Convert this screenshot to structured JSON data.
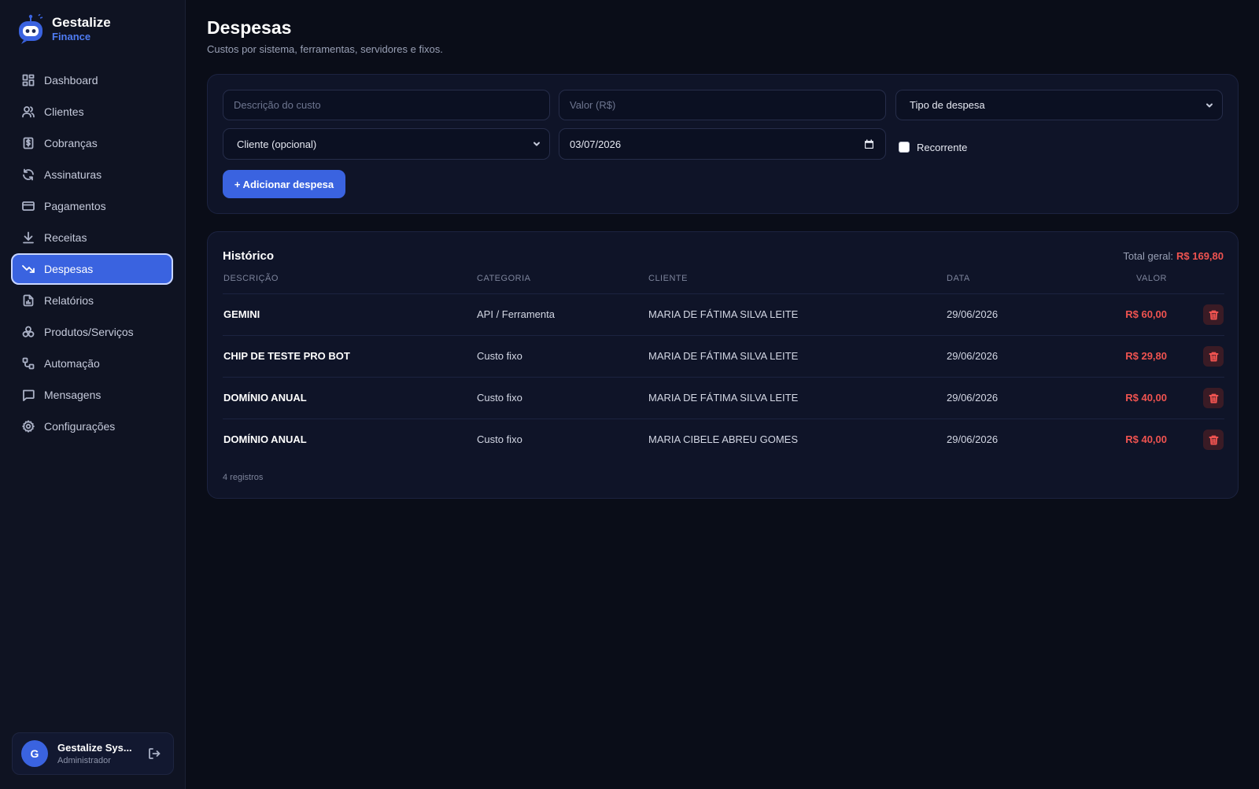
{
  "brand": {
    "name": "Gestalize",
    "sub": "Finance",
    "logo_icon": "robot-icon"
  },
  "sidebar": {
    "items": [
      {
        "label": "Dashboard",
        "icon": "dashboard-icon"
      },
      {
        "label": "Clientes",
        "icon": "users-icon"
      },
      {
        "label": "Cobranças",
        "icon": "invoice-dollar-icon"
      },
      {
        "label": "Assinaturas",
        "icon": "refresh-icon"
      },
      {
        "label": "Pagamentos",
        "icon": "credit-card-icon"
      },
      {
        "label": "Receitas",
        "icon": "download-icon"
      },
      {
        "label": "Despesas",
        "icon": "trending-down-icon",
        "active": true
      },
      {
        "label": "Relatórios",
        "icon": "report-icon"
      },
      {
        "label": "Produtos/Serviços",
        "icon": "boxes-icon"
      },
      {
        "label": "Automação",
        "icon": "workflow-icon"
      },
      {
        "label": "Mensagens",
        "icon": "message-icon"
      },
      {
        "label": "Configurações",
        "icon": "gear-icon"
      }
    ]
  },
  "user": {
    "initial": "G",
    "name": "Gestalize Sys...",
    "role": "Administrador"
  },
  "page": {
    "title": "Despesas",
    "subtitle": "Custos por sistema, ferramentas, servidores e fixos."
  },
  "form": {
    "description_placeholder": "Descrição do custo",
    "value_placeholder": "Valor (R$)",
    "type_select": "Tipo de despesa",
    "client_select": "Cliente (opcional)",
    "date_value": "03/07/2026",
    "recurring_label": "Recorrente",
    "recurring_checked": false,
    "add_button": "+ Adicionar despesa"
  },
  "history": {
    "title": "Histórico",
    "total_label": "Total geral:",
    "total_value": "R$ 169,80",
    "columns": {
      "desc": "DESCRIÇÃO",
      "category": "CATEGORIA",
      "client": "CLIENTE",
      "date": "DATA",
      "value": "VALOR"
    },
    "rows": [
      {
        "desc": "GEMINI",
        "category": "API / Ferramenta",
        "client": "MARIA DE FÁTIMA SILVA LEITE",
        "date": "29/06/2026",
        "value": "R$ 60,00"
      },
      {
        "desc": "CHIP DE TESTE PRO BOT",
        "category": "Custo fixo",
        "client": "MARIA DE FÁTIMA SILVA LEITE",
        "date": "29/06/2026",
        "value": "R$ 29,80"
      },
      {
        "desc": "DOMÍNIO ANUAL",
        "category": "Custo fixo",
        "client": "MARIA DE FÁTIMA SILVA LEITE",
        "date": "29/06/2026",
        "value": "R$ 40,00"
      },
      {
        "desc": "DOMÍNIO ANUAL",
        "category": "Custo fixo",
        "client": "MARIA CIBELE ABREU GOMES",
        "date": "29/06/2026",
        "value": "R$ 40,00"
      }
    ],
    "count": "4 registros"
  },
  "colors": {
    "accent": "#3a63e0",
    "danger": "#ef5350",
    "background": "#0a0d18",
    "sidebar": "#0f1322"
  }
}
